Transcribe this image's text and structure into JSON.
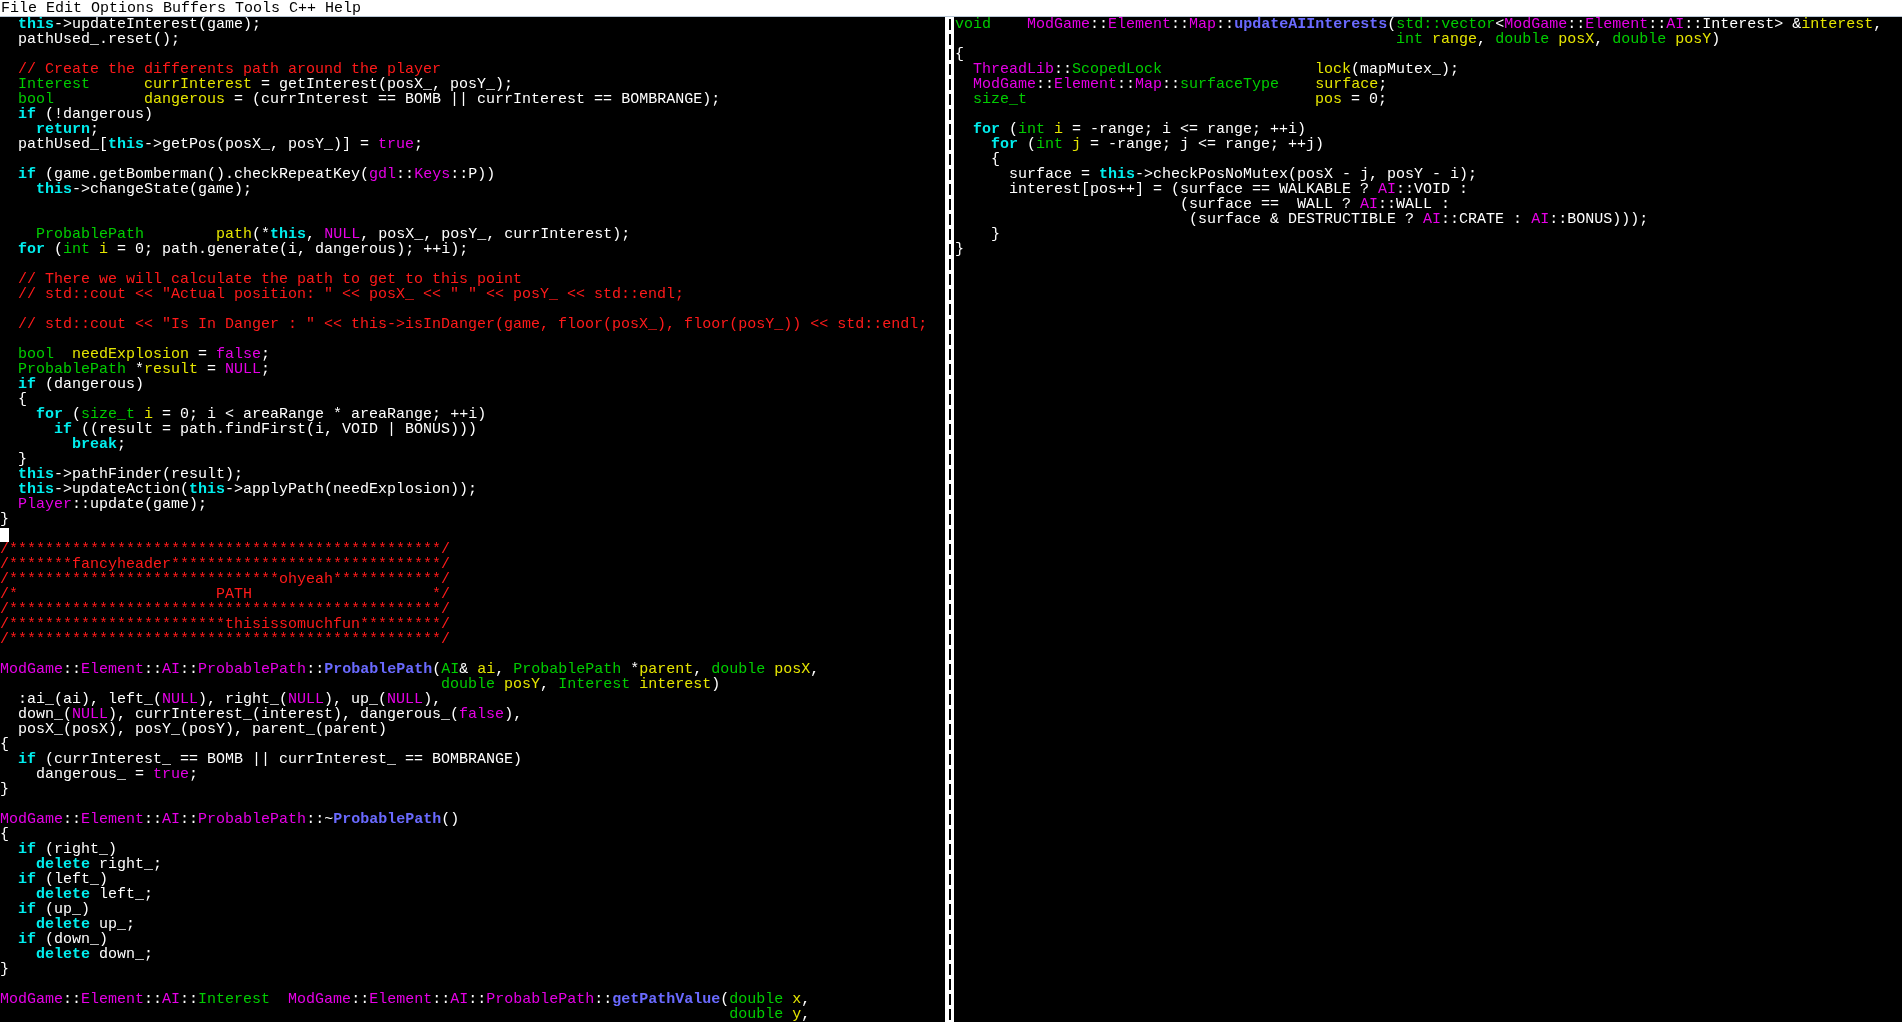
{
  "menu_bar": {
    "items": [
      "File",
      "Edit",
      "Options",
      "Buffers",
      "Tools",
      "C++",
      "Help"
    ]
  },
  "windows": [
    {
      "lines": [
        {
          "kind": "code",
          "tokens": [
            {
              "text": "  this",
              "kind": "keyword"
            },
            {
              "text": "->updateInterest(game);",
              "kind": "plain"
            }
          ]
        },
        {
          "kind": "code",
          "tokens": [
            {
              "text": "  pathUsed_.reset();",
              "kind": "plain"
            }
          ]
        },
        {
          "kind": "blank"
        },
        {
          "kind": "code",
          "tokens": [
            {
              "text": "  // Create the differents path around the player",
              "kind": "comment"
            }
          ]
        },
        {
          "kind": "code",
          "tokens": [
            {
              "text": "  Interest",
              "kind": "type"
            },
            {
              "text": "      currInterest",
              "kind": "variable"
            },
            {
              "text": " = getInterest(posX_, posY_);",
              "kind": "plain"
            }
          ]
        },
        {
          "kind": "code",
          "tokens": [
            {
              "text": "  bool",
              "kind": "type"
            },
            {
              "text": "          dangerous",
              "kind": "variable"
            },
            {
              "text": " = (currInterest == BOMB || currInterest == BOMBRANGE);",
              "kind": "plain"
            }
          ]
        },
        {
          "kind": "code",
          "tokens": [
            {
              "text": "  if",
              "kind": "keyword"
            },
            {
              "text": " (!dangerous)",
              "kind": "plain"
            }
          ]
        },
        {
          "kind": "code",
          "tokens": [
            {
              "text": "    return",
              "kind": "keyword"
            },
            {
              "text": ";",
              "kind": "plain"
            }
          ]
        },
        {
          "kind": "code",
          "tokens": [
            {
              "text": "  pathUsed_[",
              "kind": "plain"
            },
            {
              "text": "this",
              "kind": "keyword"
            },
            {
              "text": "->getPos(posX_, posY_)] = ",
              "kind": "plain"
            },
            {
              "text": "true",
              "kind": "constant"
            },
            {
              "text": ";",
              "kind": "plain"
            }
          ]
        },
        {
          "kind": "blank"
        },
        {
          "kind": "code",
          "tokens": [
            {
              "text": "  if",
              "kind": "keyword"
            },
            {
              "text": " (game.getBomberman().checkRepeatKey(",
              "kind": "plain"
            },
            {
              "text": "gdl",
              "kind": "constant"
            },
            {
              "text": "::",
              "kind": "plain"
            },
            {
              "text": "Keys",
              "kind": "constant"
            },
            {
              "text": "::P))",
              "kind": "plain"
            }
          ]
        },
        {
          "kind": "code",
          "tokens": [
            {
              "text": "    this",
              "kind": "keyword"
            },
            {
              "text": "->changeState(game);",
              "kind": "plain"
            }
          ]
        },
        {
          "kind": "blank"
        },
        {
          "kind": "blank"
        },
        {
          "kind": "code",
          "tokens": [
            {
              "text": "    ProbablePath",
              "kind": "type"
            },
            {
              "text": "        path",
              "kind": "variable"
            },
            {
              "text": "(*",
              "kind": "plain"
            },
            {
              "text": "this",
              "kind": "keyword"
            },
            {
              "text": ", ",
              "kind": "plain"
            },
            {
              "text": "NULL",
              "kind": "constant"
            },
            {
              "text": ", posX_, posY_, currInterest);",
              "kind": "plain"
            }
          ]
        },
        {
          "kind": "code",
          "tokens": [
            {
              "text": "  for",
              "kind": "keyword"
            },
            {
              "text": " (",
              "kind": "plain"
            },
            {
              "text": "int",
              "kind": "type"
            },
            {
              "text": " i",
              "kind": "variable"
            },
            {
              "text": " = 0; path.generate(i, dangerous); ++i);",
              "kind": "plain"
            }
          ]
        },
        {
          "kind": "blank"
        },
        {
          "kind": "code",
          "tokens": [
            {
              "text": "  // There we will calculate the path to get to this point",
              "kind": "comment"
            }
          ]
        },
        {
          "kind": "code",
          "tokens": [
            {
              "text": "  // std::cout << \"Actual position: \" << posX_ << \" \" << posY_ << std::endl;",
              "kind": "comment"
            }
          ]
        },
        {
          "kind": "blank"
        },
        {
          "kind": "code",
          "tokens": [
            {
              "text": "  // std::cout << \"Is In Danger : \" << this->isInDanger(game, floor(posX_), floor(posY_)) << std::endl;",
              "kind": "comment"
            }
          ]
        },
        {
          "kind": "blank"
        },
        {
          "kind": "code",
          "tokens": [
            {
              "text": "  bool",
              "kind": "type"
            },
            {
              "text": "  needExplosion",
              "kind": "variable"
            },
            {
              "text": " = ",
              "kind": "plain"
            },
            {
              "text": "false",
              "kind": "constant"
            },
            {
              "text": ";",
              "kind": "plain"
            }
          ]
        },
        {
          "kind": "code",
          "tokens": [
            {
              "text": "  ProbablePath",
              "kind": "type"
            },
            {
              "text": " *",
              "kind": "plain"
            },
            {
              "text": "result",
              "kind": "variable"
            },
            {
              "text": " = ",
              "kind": "plain"
            },
            {
              "text": "NULL",
              "kind": "constant"
            },
            {
              "text": ";",
              "kind": "plain"
            }
          ]
        },
        {
          "kind": "code",
          "tokens": [
            {
              "text": "  if",
              "kind": "keyword"
            },
            {
              "text": " (dangerous)",
              "kind": "plain"
            }
          ]
        },
        {
          "kind": "code",
          "tokens": [
            {
              "text": "  {",
              "kind": "plain"
            }
          ]
        },
        {
          "kind": "code",
          "tokens": [
            {
              "text": "    for",
              "kind": "keyword"
            },
            {
              "text": " (",
              "kind": "plain"
            },
            {
              "text": "size_t",
              "kind": "type"
            },
            {
              "text": " i",
              "kind": "variable"
            },
            {
              "text": " = 0; i < areaRange * areaRange; ++i)",
              "kind": "plain"
            }
          ]
        },
        {
          "kind": "code",
          "tokens": [
            {
              "text": "      if",
              "kind": "keyword"
            },
            {
              "text": " ((result = path.findFirst(i, VOID | BONUS)))",
              "kind": "plain"
            }
          ]
        },
        {
          "kind": "code",
          "tokens": [
            {
              "text": "        break",
              "kind": "keyword"
            },
            {
              "text": ";",
              "kind": "plain"
            }
          ]
        },
        {
          "kind": "code",
          "tokens": [
            {
              "text": "  }",
              "kind": "plain"
            }
          ]
        },
        {
          "kind": "code",
          "tokens": [
            {
              "text": "  this",
              "kind": "keyword"
            },
            {
              "text": "->pathFinder(result);",
              "kind": "plain"
            }
          ]
        },
        {
          "kind": "code",
          "tokens": [
            {
              "text": "  this",
              "kind": "keyword"
            },
            {
              "text": "->updateAction(",
              "kind": "plain"
            },
            {
              "text": "this",
              "kind": "keyword"
            },
            {
              "text": "->applyPath(needExplosion));",
              "kind": "plain"
            }
          ]
        },
        {
          "kind": "code",
          "tokens": [
            {
              "text": "  Player",
              "kind": "constant"
            },
            {
              "text": "::update(game);",
              "kind": "plain"
            }
          ]
        },
        {
          "kind": "code",
          "tokens": [
            {
              "text": "}",
              "kind": "plain"
            }
          ]
        },
        {
          "kind": "cursor"
        },
        {
          "kind": "code",
          "tokens": [
            {
              "text": "/************************************************/",
              "kind": "comment"
            }
          ]
        },
        {
          "kind": "code",
          "tokens": [
            {
              "text": "/*******fancyheader******************************/",
              "kind": "comment"
            }
          ]
        },
        {
          "kind": "code",
          "tokens": [
            {
              "text": "/******************************ohyeah************/",
              "kind": "comment"
            }
          ]
        },
        {
          "kind": "code",
          "tokens": [
            {
              "text": "/*                      PATH                    */",
              "kind": "comment"
            }
          ]
        },
        {
          "kind": "code",
          "tokens": [
            {
              "text": "/************************************************/",
              "kind": "comment"
            }
          ]
        },
        {
          "kind": "code",
          "tokens": [
            {
              "text": "/************************thisissomuchfun*********/",
              "kind": "comment"
            }
          ]
        },
        {
          "kind": "code",
          "tokens": [
            {
              "text": "/************************************************/",
              "kind": "comment"
            }
          ]
        },
        {
          "kind": "blank"
        },
        {
          "kind": "code",
          "tokens": [
            {
              "text": "ModGame",
              "kind": "constant"
            },
            {
              "text": "::",
              "kind": "plain"
            },
            {
              "text": "Element",
              "kind": "constant"
            },
            {
              "text": "::",
              "kind": "plain"
            },
            {
              "text": "AI",
              "kind": "constant"
            },
            {
              "text": "::",
              "kind": "plain"
            },
            {
              "text": "ProbablePath",
              "kind": "constant"
            },
            {
              "text": "::",
              "kind": "plain"
            },
            {
              "text": "ProbablePath",
              "kind": "function"
            },
            {
              "text": "(",
              "kind": "plain"
            },
            {
              "text": "AI",
              "kind": "type"
            },
            {
              "text": "& ",
              "kind": "plain"
            },
            {
              "text": "ai",
              "kind": "variable"
            },
            {
              "text": ", ",
              "kind": "plain"
            },
            {
              "text": "ProbablePath",
              "kind": "type"
            },
            {
              "text": " *",
              "kind": "plain"
            },
            {
              "text": "parent",
              "kind": "variable"
            },
            {
              "text": ", ",
              "kind": "plain"
            },
            {
              "text": "double",
              "kind": "type"
            },
            {
              "text": " posX",
              "kind": "variable"
            },
            {
              "text": ",",
              "kind": "plain"
            }
          ]
        },
        {
          "kind": "code",
          "tokens": [
            {
              "text": "                                                 double",
              "kind": "type"
            },
            {
              "text": " posY",
              "kind": "variable"
            },
            {
              "text": ", ",
              "kind": "plain"
            },
            {
              "text": "Interest",
              "kind": "type"
            },
            {
              "text": " interest",
              "kind": "variable"
            },
            {
              "text": ")",
              "kind": "plain"
            }
          ]
        },
        {
          "kind": "code",
          "tokens": [
            {
              "text": "  :ai_(ai), left_(",
              "kind": "plain"
            },
            {
              "text": "NULL",
              "kind": "constant"
            },
            {
              "text": "), right_(",
              "kind": "plain"
            },
            {
              "text": "NULL",
              "kind": "constant"
            },
            {
              "text": "), up_(",
              "kind": "plain"
            },
            {
              "text": "NULL",
              "kind": "constant"
            },
            {
              "text": "),",
              "kind": "plain"
            }
          ]
        },
        {
          "kind": "code",
          "tokens": [
            {
              "text": "  down_(",
              "kind": "plain"
            },
            {
              "text": "NULL",
              "kind": "constant"
            },
            {
              "text": "), currInterest_(interest), dangerous_(",
              "kind": "plain"
            },
            {
              "text": "false",
              "kind": "constant"
            },
            {
              "text": "),",
              "kind": "plain"
            }
          ]
        },
        {
          "kind": "code",
          "tokens": [
            {
              "text": "  posX_(posX), posY_(posY), parent_(parent)",
              "kind": "plain"
            }
          ]
        },
        {
          "kind": "code",
          "tokens": [
            {
              "text": "{",
              "kind": "plain"
            }
          ]
        },
        {
          "kind": "code",
          "tokens": [
            {
              "text": "  if",
              "kind": "keyword"
            },
            {
              "text": " (currInterest_ == BOMB || currInterest_ == BOMBRANGE)",
              "kind": "plain"
            }
          ]
        },
        {
          "kind": "code",
          "tokens": [
            {
              "text": "    dangerous_ = ",
              "kind": "plain"
            },
            {
              "text": "true",
              "kind": "constant"
            },
            {
              "text": ";",
              "kind": "plain"
            }
          ]
        },
        {
          "kind": "code",
          "tokens": [
            {
              "text": "}",
              "kind": "plain"
            }
          ]
        },
        {
          "kind": "blank"
        },
        {
          "kind": "code",
          "tokens": [
            {
              "text": "ModGame",
              "kind": "constant"
            },
            {
              "text": "::",
              "kind": "plain"
            },
            {
              "text": "Element",
              "kind": "constant"
            },
            {
              "text": "::",
              "kind": "plain"
            },
            {
              "text": "AI",
              "kind": "constant"
            },
            {
              "text": "::",
              "kind": "plain"
            },
            {
              "text": "ProbablePath",
              "kind": "constant"
            },
            {
              "text": "::~",
              "kind": "plain"
            },
            {
              "text": "ProbablePath",
              "kind": "function"
            },
            {
              "text": "()",
              "kind": "plain"
            }
          ]
        },
        {
          "kind": "code",
          "tokens": [
            {
              "text": "{",
              "kind": "plain"
            }
          ]
        },
        {
          "kind": "code",
          "tokens": [
            {
              "text": "  if",
              "kind": "keyword"
            },
            {
              "text": " (right_)",
              "kind": "plain"
            }
          ]
        },
        {
          "kind": "code",
          "tokens": [
            {
              "text": "    delete",
              "kind": "keyword"
            },
            {
              "text": " right_;",
              "kind": "plain"
            }
          ]
        },
        {
          "kind": "code",
          "tokens": [
            {
              "text": "  if",
              "kind": "keyword"
            },
            {
              "text": " (left_)",
              "kind": "plain"
            }
          ]
        },
        {
          "kind": "code",
          "tokens": [
            {
              "text": "    delete",
              "kind": "keyword"
            },
            {
              "text": " left_;",
              "kind": "plain"
            }
          ]
        },
        {
          "kind": "code",
          "tokens": [
            {
              "text": "  if",
              "kind": "keyword"
            },
            {
              "text": " (up_)",
              "kind": "plain"
            }
          ]
        },
        {
          "kind": "code",
          "tokens": [
            {
              "text": "    delete",
              "kind": "keyword"
            },
            {
              "text": " up_;",
              "kind": "plain"
            }
          ]
        },
        {
          "kind": "code",
          "tokens": [
            {
              "text": "  if",
              "kind": "keyword"
            },
            {
              "text": " (down_)",
              "kind": "plain"
            }
          ]
        },
        {
          "kind": "code",
          "tokens": [
            {
              "text": "    delete",
              "kind": "keyword"
            },
            {
              "text": " down_;",
              "kind": "plain"
            }
          ]
        },
        {
          "kind": "code",
          "tokens": [
            {
              "text": "}",
              "kind": "plain"
            }
          ]
        },
        {
          "kind": "blank"
        },
        {
          "kind": "code",
          "tokens": [
            {
              "text": "ModGame",
              "kind": "constant"
            },
            {
              "text": "::",
              "kind": "plain"
            },
            {
              "text": "Element",
              "kind": "constant"
            },
            {
              "text": "::",
              "kind": "plain"
            },
            {
              "text": "AI",
              "kind": "constant"
            },
            {
              "text": "::",
              "kind": "plain"
            },
            {
              "text": "Interest",
              "kind": "type"
            },
            {
              "text": "  ModGame",
              "kind": "constant"
            },
            {
              "text": "::",
              "kind": "plain"
            },
            {
              "text": "Element",
              "kind": "constant"
            },
            {
              "text": "::",
              "kind": "plain"
            },
            {
              "text": "AI",
              "kind": "constant"
            },
            {
              "text": "::",
              "kind": "plain"
            },
            {
              "text": "ProbablePath",
              "kind": "constant"
            },
            {
              "text": "::",
              "kind": "plain"
            },
            {
              "text": "getPathValue",
              "kind": "function"
            },
            {
              "text": "(",
              "kind": "plain"
            },
            {
              "text": "double",
              "kind": "type"
            },
            {
              "text": " x",
              "kind": "variable"
            },
            {
              "text": ",",
              "kind": "plain"
            }
          ]
        },
        {
          "kind": "code",
          "tokens": [
            {
              "text": "                                                                                 double",
              "kind": "type"
            },
            {
              "text": " y",
              "kind": "variable"
            },
            {
              "text": ",",
              "kind": "plain"
            }
          ]
        }
      ]
    },
    {
      "lines": [
        {
          "kind": "code",
          "tokens": [
            {
              "text": "void",
              "kind": "type"
            },
            {
              "text": "    ModGame",
              "kind": "constant"
            },
            {
              "text": "::",
              "kind": "plain"
            },
            {
              "text": "Element",
              "kind": "constant"
            },
            {
              "text": "::",
              "kind": "plain"
            },
            {
              "text": "Map",
              "kind": "constant"
            },
            {
              "text": "::",
              "kind": "plain"
            },
            {
              "text": "updateAIInterests",
              "kind": "function"
            },
            {
              "text": "(",
              "kind": "plain"
            },
            {
              "text": "std::vector",
              "kind": "type"
            },
            {
              "text": "<",
              "kind": "plain"
            },
            {
              "text": "ModGame",
              "kind": "constant"
            },
            {
              "text": "::",
              "kind": "plain"
            },
            {
              "text": "Element",
              "kind": "constant"
            },
            {
              "text": "::",
              "kind": "plain"
            },
            {
              "text": "AI",
              "kind": "constant"
            },
            {
              "text": "::Interest> &",
              "kind": "plain"
            },
            {
              "text": "interest",
              "kind": "variable"
            },
            {
              "text": ",",
              "kind": "plain"
            }
          ]
        },
        {
          "kind": "code",
          "tokens": [
            {
              "text": "                                                 int",
              "kind": "type"
            },
            {
              "text": " range",
              "kind": "variable"
            },
            {
              "text": ", ",
              "kind": "plain"
            },
            {
              "text": "double",
              "kind": "type"
            },
            {
              "text": " posX",
              "kind": "variable"
            },
            {
              "text": ", ",
              "kind": "plain"
            },
            {
              "text": "double",
              "kind": "type"
            },
            {
              "text": " posY",
              "kind": "variable"
            },
            {
              "text": ")",
              "kind": "plain"
            }
          ]
        },
        {
          "kind": "code",
          "tokens": [
            {
              "text": "{",
              "kind": "plain"
            }
          ]
        },
        {
          "kind": "code",
          "tokens": [
            {
              "text": "  ThreadLib",
              "kind": "constant"
            },
            {
              "text": "::",
              "kind": "plain"
            },
            {
              "text": "ScopedLock",
              "kind": "type"
            },
            {
              "text": "                 lock",
              "kind": "variable"
            },
            {
              "text": "(mapMutex_);",
              "kind": "plain"
            }
          ]
        },
        {
          "kind": "code",
          "tokens": [
            {
              "text": "  ModGame",
              "kind": "constant"
            },
            {
              "text": "::",
              "kind": "plain"
            },
            {
              "text": "Element",
              "kind": "constant"
            },
            {
              "text": "::",
              "kind": "plain"
            },
            {
              "text": "Map",
              "kind": "constant"
            },
            {
              "text": "::",
              "kind": "plain"
            },
            {
              "text": "surfaceType",
              "kind": "type"
            },
            {
              "text": "    surface",
              "kind": "variable"
            },
            {
              "text": ";",
              "kind": "plain"
            }
          ]
        },
        {
          "kind": "code",
          "tokens": [
            {
              "text": "  size_t",
              "kind": "type"
            },
            {
              "text": "                                pos",
              "kind": "variable"
            },
            {
              "text": " = 0;",
              "kind": "plain"
            }
          ]
        },
        {
          "kind": "blank"
        },
        {
          "kind": "code",
          "tokens": [
            {
              "text": "  for",
              "kind": "keyword"
            },
            {
              "text": " (",
              "kind": "plain"
            },
            {
              "text": "int",
              "kind": "type"
            },
            {
              "text": " i",
              "kind": "variable"
            },
            {
              "text": " = -range; i <= range; ++i)",
              "kind": "plain"
            }
          ]
        },
        {
          "kind": "code",
          "tokens": [
            {
              "text": "    for",
              "kind": "keyword"
            },
            {
              "text": " (",
              "kind": "plain"
            },
            {
              "text": "int",
              "kind": "type"
            },
            {
              "text": " j",
              "kind": "variable"
            },
            {
              "text": " = -range; j <= range; ++j)",
              "kind": "plain"
            }
          ]
        },
        {
          "kind": "code",
          "tokens": [
            {
              "text": "    {",
              "kind": "plain"
            }
          ]
        },
        {
          "kind": "code",
          "tokens": [
            {
              "text": "      surface = ",
              "kind": "plain"
            },
            {
              "text": "this",
              "kind": "keyword"
            },
            {
              "text": "->checkPosNoMutex(posX - j, posY - i);",
              "kind": "plain"
            }
          ]
        },
        {
          "kind": "code",
          "tokens": [
            {
              "text": "      interest[pos++] = (surface == WALKABLE ? ",
              "kind": "plain"
            },
            {
              "text": "AI",
              "kind": "constant"
            },
            {
              "text": "::VOID :",
              "kind": "plain"
            }
          ]
        },
        {
          "kind": "code",
          "tokens": [
            {
              "text": "                         (surface ==  WALL ? ",
              "kind": "plain"
            },
            {
              "text": "AI",
              "kind": "constant"
            },
            {
              "text": "::WALL :",
              "kind": "plain"
            }
          ]
        },
        {
          "kind": "code",
          "tokens": [
            {
              "text": "                          (surface & DESTRUCTIBLE ? ",
              "kind": "plain"
            },
            {
              "text": "AI",
              "kind": "constant"
            },
            {
              "text": "::CRATE : ",
              "kind": "plain"
            },
            {
              "text": "AI",
              "kind": "constant"
            },
            {
              "text": "::BONUS)));",
              "kind": "plain"
            }
          ]
        },
        {
          "kind": "code",
          "tokens": [
            {
              "text": "    }",
              "kind": "plain"
            }
          ]
        },
        {
          "kind": "code",
          "tokens": [
            {
              "text": "}",
              "kind": "plain"
            }
          ]
        }
      ]
    }
  ]
}
